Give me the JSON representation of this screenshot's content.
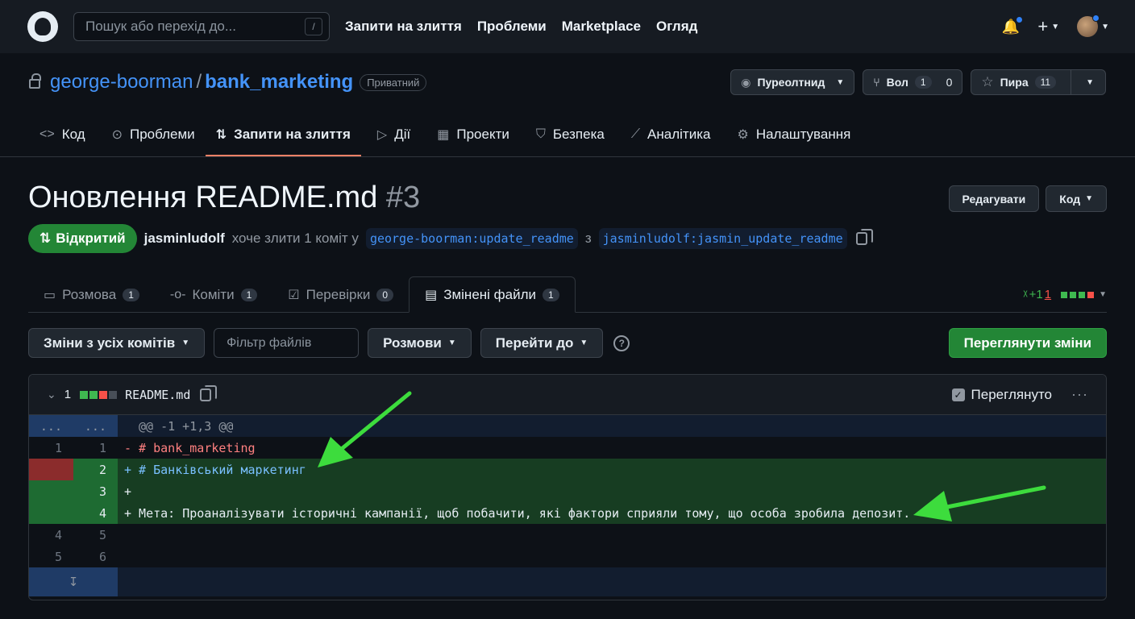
{
  "header": {
    "search_placeholder": "Пошук або перехід до...",
    "search_shortcut": "/",
    "nav": [
      "Запити на злиття",
      "Проблеми",
      "Marketplace",
      "Огляд"
    ]
  },
  "repo": {
    "owner": "george-boorman",
    "separator": "/",
    "name": "bank_marketing",
    "visibility": "Приватний",
    "watch_label": "Пуреолтнид",
    "fork_label": "Вол",
    "fork_count_left": "1",
    "fork_count": "0",
    "star_label": "Пира",
    "star_count": "11"
  },
  "repo_nav": [
    {
      "label": "Код",
      "icon": "code-icon"
    },
    {
      "label": "Проблеми",
      "icon": "issue-icon"
    },
    {
      "label": "Запити на злиття",
      "icon": "pull-request-icon"
    },
    {
      "label": "Дії",
      "icon": "play-icon"
    },
    {
      "label": "Проекти",
      "icon": "table-icon"
    },
    {
      "label": "Безпека",
      "icon": "shield-icon"
    },
    {
      "label": "Аналітика",
      "icon": "graph-icon"
    },
    {
      "label": "Налаштування",
      "icon": "gear-icon"
    }
  ],
  "pr": {
    "title": "Оновлення README.md",
    "number": "#3",
    "edit_label": "Редагувати",
    "code_label": "Код",
    "state": "Відкритий",
    "author": "jasminludolf",
    "action_text": "хоче злити 1 коміт у",
    "base_branch": "george-boorman:update_readme",
    "from_text": "з",
    "head_branch": "jasminludolf:jasmin_update_readme"
  },
  "pr_tabs": [
    {
      "label": "Розмова",
      "count": "1",
      "icon": "comment-icon"
    },
    {
      "label": "Коміти",
      "count": "1",
      "icon": "commit-icon"
    },
    {
      "label": "Перевірки",
      "count": "0",
      "icon": "checklist-icon"
    },
    {
      "label": "Змінені файли",
      "count": "1",
      "icon": "file-diff-icon"
    }
  ],
  "diffstat": {
    "additions": "+1",
    "deletions": "1",
    "prefix": "ᵡ"
  },
  "toolbar": {
    "commits_filter": "Зміни з усіх комітів",
    "file_filter_placeholder": "Фільтр файлів",
    "conversations": "Розмови",
    "jump_to": "Перейти до",
    "review_button": "Переглянути зміни"
  },
  "file": {
    "change_count": "1",
    "name": "README.md",
    "viewed_label": "Переглянуто",
    "hunk_header": "@@ -1 +1,3 @@",
    "lines": [
      {
        "old": "1",
        "new": "1",
        "type": "del",
        "text": "- # bank_marketing"
      },
      {
        "old": "",
        "new": "2",
        "type": "add",
        "text": "+ # Банківський маркетинг"
      },
      {
        "old": "",
        "new": "3",
        "type": "add",
        "text": "+"
      },
      {
        "old": "",
        "new": "4",
        "type": "add",
        "text": "+ Мета: Проаналізувати історичні кампанії, щоб побачити, які фактори сприяли тому, що особа зробила депозит."
      },
      {
        "old": "4",
        "new": "5",
        "type": "ctx",
        "text": ""
      },
      {
        "old": "5",
        "new": "6",
        "type": "ctx",
        "text": ""
      }
    ]
  },
  "colors": {
    "accent": "#4493f8",
    "success": "#238636",
    "danger": "#f85149",
    "annotation": "#3ddc3d"
  }
}
